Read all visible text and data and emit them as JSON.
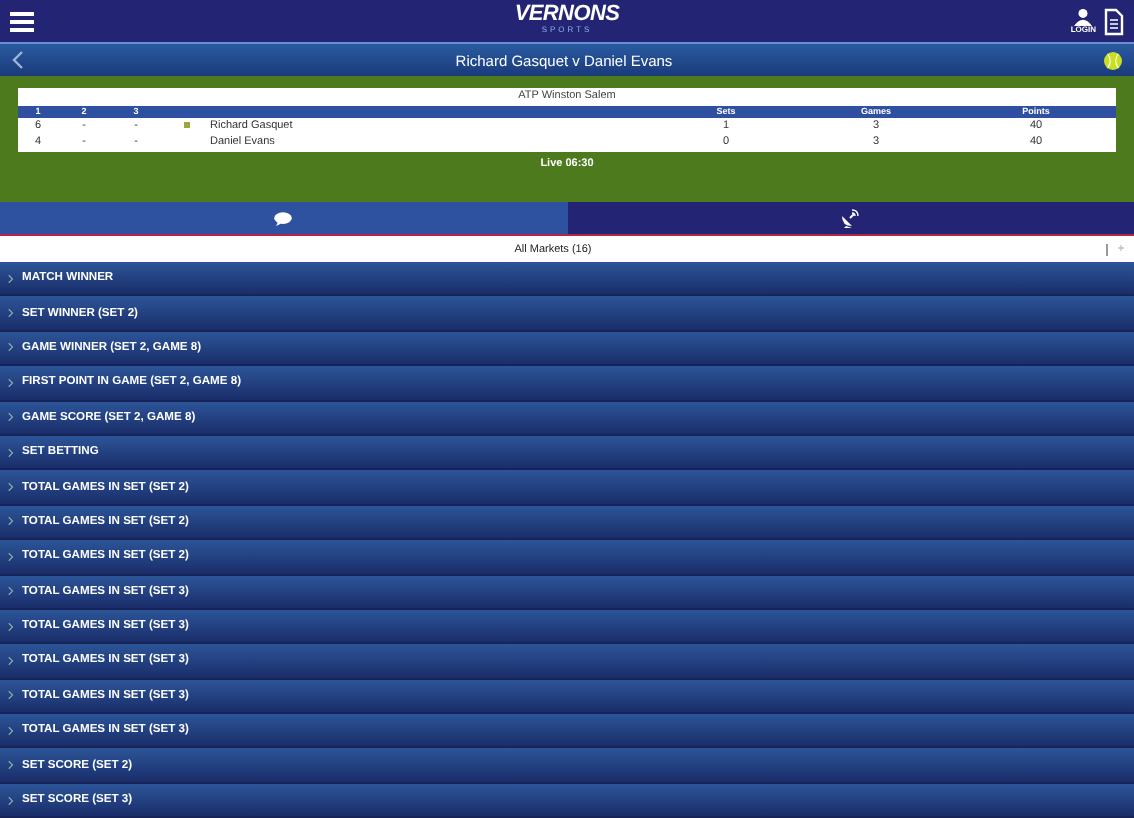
{
  "header": {
    "logo": "VERNONS",
    "logo_sub": "SPORTS",
    "login": "LOGIN"
  },
  "title_bar": {
    "title": "Richard Gasquet v Daniel Evans"
  },
  "scoreboard": {
    "tournament": "ATP Winston Salem",
    "columns": [
      "1",
      "2",
      "3",
      "Sets",
      "Games",
      "Points"
    ],
    "players": [
      {
        "sets_scores": [
          "6",
          "-",
          "-"
        ],
        "serving": true,
        "name": "Richard Gasquet",
        "sets": "1",
        "games": "3",
        "points": "40"
      },
      {
        "sets_scores": [
          "4",
          "-",
          "-"
        ],
        "serving": false,
        "name": "Daniel Evans",
        "sets": "0",
        "games": "3",
        "points": "40"
      }
    ],
    "status": "Live 06:30"
  },
  "tabs": [
    {
      "kind": "chat",
      "selected": true
    },
    {
      "kind": "stats",
      "selected": false
    }
  ],
  "filter": {
    "label": "All Markets (16)",
    "button": "+"
  },
  "markets": [
    "MATCH WINNER",
    "SET WINNER (SET 2)",
    "GAME WINNER (SET 2, GAME 8)",
    "FIRST POINT IN GAME (SET 2, GAME 8)",
    "GAME SCORE (SET 2, GAME 8)",
    "SET BETTING",
    "TOTAL GAMES IN SET (SET 2)",
    "TOTAL GAMES IN SET (SET 2)",
    "TOTAL GAMES IN SET (SET 2)",
    "TOTAL GAMES IN SET (SET 3)",
    "TOTAL GAMES IN SET (SET 3)",
    "TOTAL GAMES IN SET (SET 3)",
    "TOTAL GAMES IN SET (SET 3)",
    "TOTAL GAMES IN SET (SET 3)",
    "SET SCORE (SET 2)",
    "SET SCORE (SET 3)"
  ]
}
